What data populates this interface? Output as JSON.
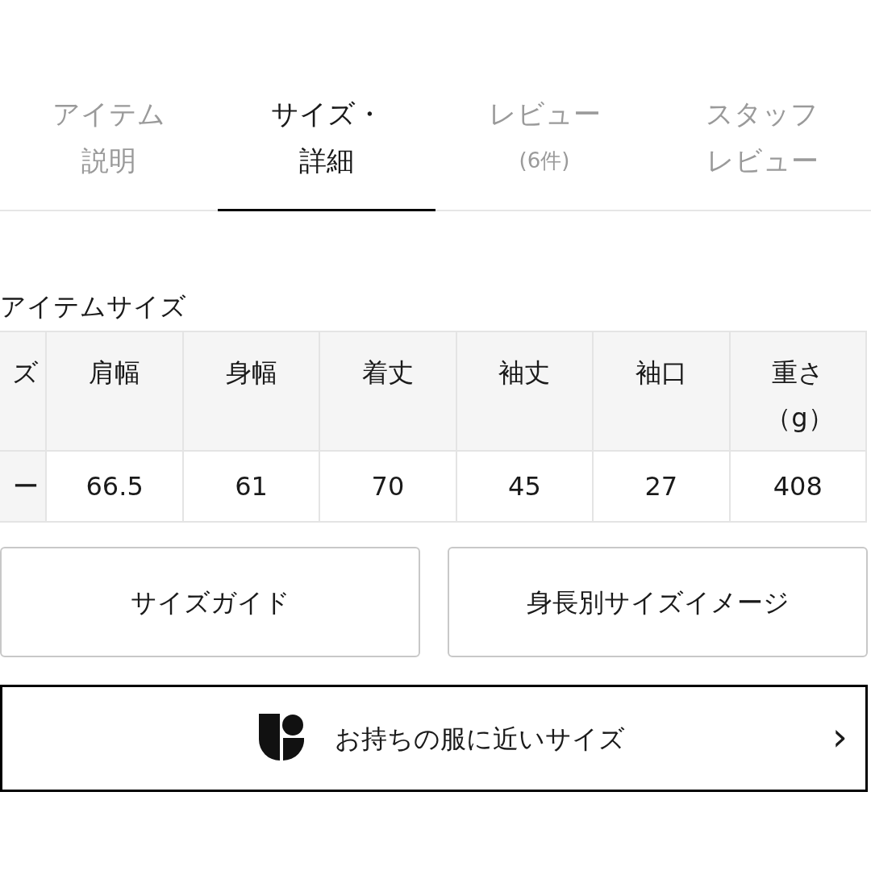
{
  "tabs": [
    {
      "lines": [
        "アイテム",
        "説明"
      ],
      "selected": false
    },
    {
      "lines": [
        "サイズ・",
        "詳細"
      ],
      "selected": true
    },
    {
      "lines": [
        "レビュー"
      ],
      "count": "(6件)",
      "selected": false
    },
    {
      "lines": [
        "スタッフ",
        "レビュー"
      ],
      "selected": false
    }
  ],
  "size_section": {
    "title": "アイテムサイズ",
    "table": {
      "columns": [
        "ズ",
        "肩幅",
        "身幅",
        "着丈",
        "袖丈",
        "袖口",
        "重さ（g）"
      ],
      "rows": [
        [
          "ー",
          "66.5",
          "61",
          "70",
          "45",
          "27",
          "408"
        ]
      ]
    }
  },
  "buttons": [
    "サイズガイド",
    "身長別サイズイメージ"
  ],
  "fit_link": {
    "label": "お持ちの服に近いサイズ",
    "chevron": "›"
  }
}
